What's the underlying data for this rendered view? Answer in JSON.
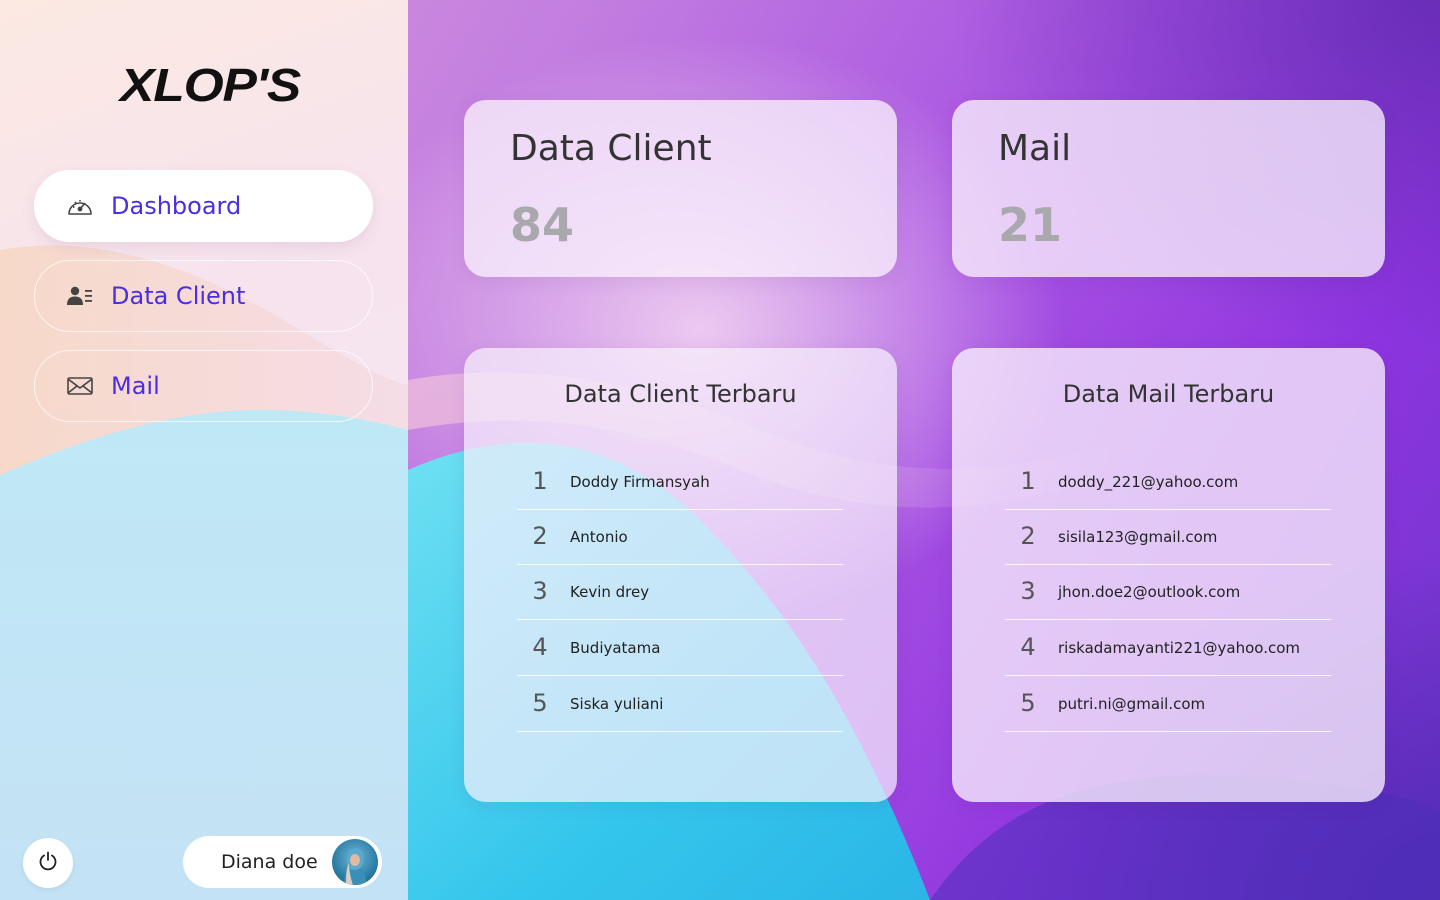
{
  "brand": {
    "logo_text": "XLOP'S"
  },
  "sidebar": {
    "items": [
      {
        "label": "Dashboard",
        "icon": "dashboard-gauge-icon",
        "active": true
      },
      {
        "label": "Data Client",
        "icon": "client-list-icon",
        "active": false
      },
      {
        "label": "Mail",
        "icon": "mail-envelope-icon",
        "active": false
      }
    ]
  },
  "user": {
    "name": "Diana doe",
    "power_icon": "power-icon"
  },
  "stats": [
    {
      "title": "Data Client",
      "value": "84"
    },
    {
      "title": "Mail",
      "value": "21"
    }
  ],
  "clients": {
    "heading": "Data Client Terbaru",
    "rows": [
      {
        "num": "1",
        "name": "Doddy Firmansyah"
      },
      {
        "num": "2",
        "name": "Antonio"
      },
      {
        "num": "3",
        "name": "Kevin drey"
      },
      {
        "num": "4",
        "name": "Budiyatama"
      },
      {
        "num": "5",
        "name": "Siska yuliani"
      }
    ]
  },
  "mails": {
    "heading": "Data Mail Terbaru",
    "rows": [
      {
        "num": "1",
        "email": "doddy_221@yahoo.com"
      },
      {
        "num": "2",
        "email": "sisila123@gmail.com"
      },
      {
        "num": "3",
        "email": "jhon.doe2@outlook.com"
      },
      {
        "num": "4",
        "email": "riskadamayanti221@yahoo.com"
      },
      {
        "num": "5",
        "email": "putri.ni@gmail.com"
      }
    ]
  },
  "colors": {
    "accent": "#4a2ee0",
    "stat_value": "#a9a9ad"
  }
}
